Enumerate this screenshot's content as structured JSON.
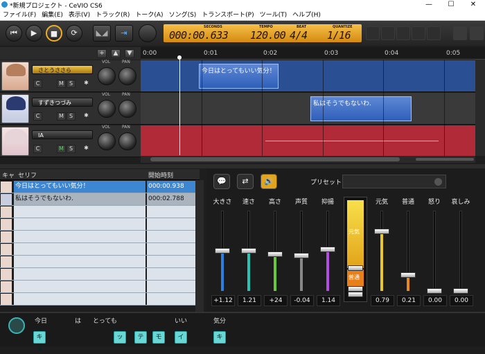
{
  "window": {
    "title": "*新規プロジェクト - CeVIO CS6",
    "minimize": "—",
    "maximize": "☐",
    "close": "✕"
  },
  "menu": [
    "ファイル(F)",
    "編集(E)",
    "表示(V)",
    "トラック(R)",
    "トーク(A)",
    "ソング(S)",
    "トランスポート(P)",
    "ツール(T)",
    "ヘルプ(H)"
  ],
  "toolbar": {
    "rewind": "⏮",
    "play": "▶",
    "stop": "■",
    "loop": "⟳",
    "btn5": "◣◢",
    "btn6": "⇥"
  },
  "lcd": {
    "seconds_label": "SECONDS",
    "seconds": "000:00.633",
    "tempo_label": "TEMPO",
    "tempo": "120.00",
    "beat_label": "BEAT",
    "beat": "4/4",
    "quantize_label": "QUANTIZE",
    "quantize": "1/16"
  },
  "track_controls": {
    "add": "+",
    "up": "▲",
    "down": "▼",
    "vol": "VOL",
    "pan": "PAN",
    "c": "C",
    "m": "M",
    "s": "S",
    "gear": "✱"
  },
  "ruler": [
    "0:00",
    "0:01",
    "0:02",
    "0:03",
    "0:04",
    "0:05"
  ],
  "tracks": [
    {
      "name": "さとうささら",
      "note": "今日はとってもいい気分！"
    },
    {
      "name": "すずきつづみ",
      "note": "私はそうでもないわ."
    },
    {
      "name": "IA",
      "note": ""
    }
  ],
  "list": {
    "col_char": "キャ",
    "col_line": "セリフ",
    "col_time": "開始時刻",
    "rows": [
      {
        "line": "今日はとってもいい気分！",
        "time": "000:00.938"
      },
      {
        "line": "私はそうでもないわ.",
        "time": "000:02.788"
      }
    ]
  },
  "panel": {
    "preset_label": "プリセット",
    "btn1": "💬",
    "btn2": "⇄",
    "btn3": "🔊",
    "faders": [
      {
        "label": "大きさ",
        "value": "+1.12",
        "level": 0.5,
        "color": "#2b7fe0"
      },
      {
        "label": "速さ",
        "value": "1.21",
        "level": 0.5,
        "color": "#29c3b4"
      },
      {
        "label": "高さ",
        "value": "+24",
        "level": 0.46,
        "color": "#6ac837"
      },
      {
        "label": "声質",
        "value": "-0.04",
        "level": 0.44,
        "color": "#888888"
      },
      {
        "label": "抑揚",
        "value": "1.14",
        "level": 0.52,
        "color": "#b14ee0"
      }
    ],
    "emotion_labels": {
      "genki": "元気",
      "futsuu": "普通"
    },
    "emotions": [
      {
        "label": "元気",
        "value": "0.79",
        "level": 0.74,
        "color": "#e8c72a"
      },
      {
        "label": "普通",
        "value": "0.21",
        "level": 0.2,
        "color": "#e88a1a"
      },
      {
        "label": "怒り",
        "value": "0.00",
        "level": 0.0,
        "color": "#555555"
      },
      {
        "label": "哀しみ",
        "value": "0.00",
        "level": 0.0,
        "color": "#555555"
      }
    ]
  },
  "phrase": {
    "words": [
      "今日",
      "は",
      "とっても",
      "いい",
      "気分"
    ],
    "kana": [
      "キョ",
      "ッ",
      "テ",
      "モ",
      "イ",
      "キ"
    ]
  }
}
